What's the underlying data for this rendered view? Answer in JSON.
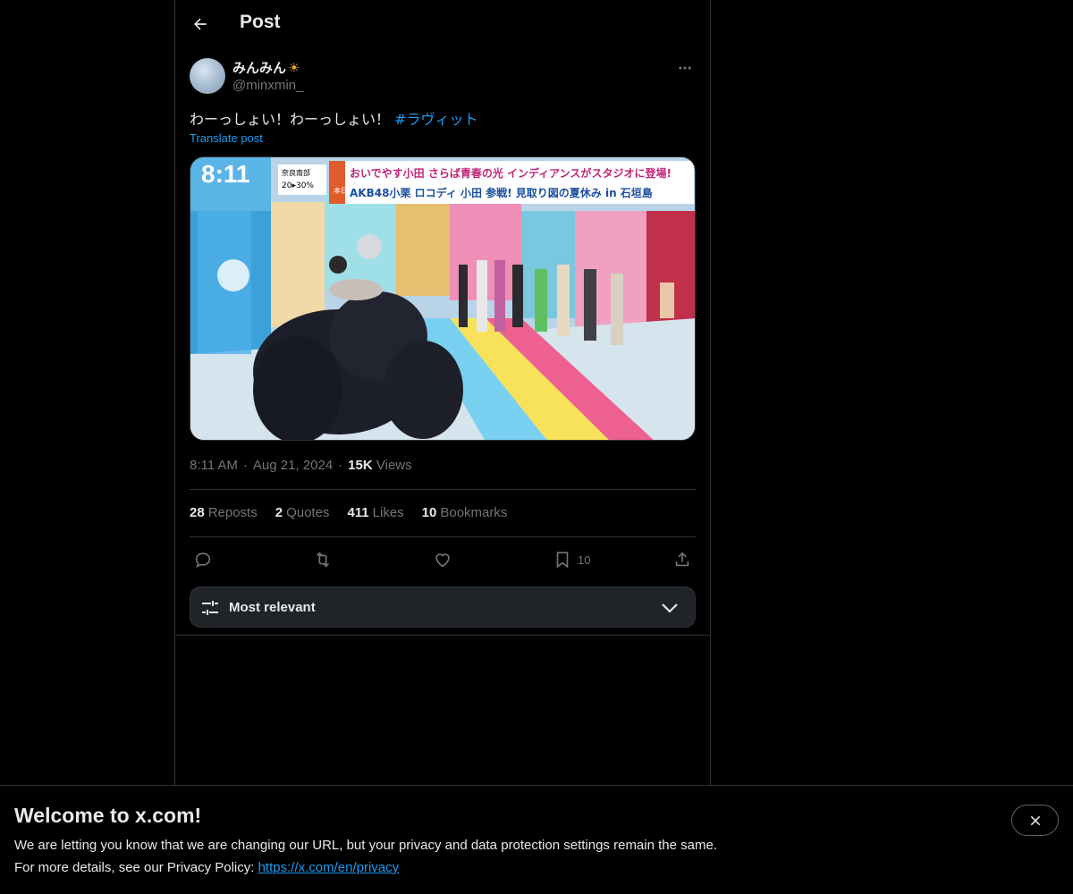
{
  "header": {
    "title": "Post",
    "back_icon": "arrow-left-icon"
  },
  "author": {
    "display_name": "みんみん",
    "emoji": "☀",
    "handle": "@minxmin_",
    "more_icon": "more-horizontal-icon"
  },
  "post": {
    "text": "わーっしょい！わーっしょい！ ",
    "hashtag": "#ラヴィット",
    "translate_label": "Translate post"
  },
  "media": {
    "clock": "8:11",
    "forecast_region": "奈良南部",
    "forecast": "20▸30%",
    "side_label": "本日は",
    "headline1": "おいでやす小田 さらば青春の光 インディアンスがスタジオに登場!",
    "headline2": "AKB48小栗 ロコディ 小田 参戦! 見取り図の夏休み in 石垣島"
  },
  "meta": {
    "time": "8:11 AM",
    "date": "Aug 21, 2024",
    "views_count": "15K",
    "views_label": "Views"
  },
  "stats": [
    {
      "count": "28",
      "label": "Reposts"
    },
    {
      "count": "2",
      "label": "Quotes"
    },
    {
      "count": "411",
      "label": "Likes"
    },
    {
      "count": "10",
      "label": "Bookmarks"
    }
  ],
  "actions": {
    "bookmark_count": "10"
  },
  "sort": {
    "label": "Most relevant"
  },
  "banner": {
    "title": "Welcome to x.com!",
    "line1": "We are letting you know that we are changing our URL, but your privacy and data protection settings remain the same.",
    "line2_prefix": "For more details, see our Privacy Policy: ",
    "link": "https://x.com/en/privacy"
  },
  "colors": {
    "accent": "#1d9bf0",
    "background": "#000000",
    "border": "#2f3336",
    "muted": "#71767b"
  }
}
